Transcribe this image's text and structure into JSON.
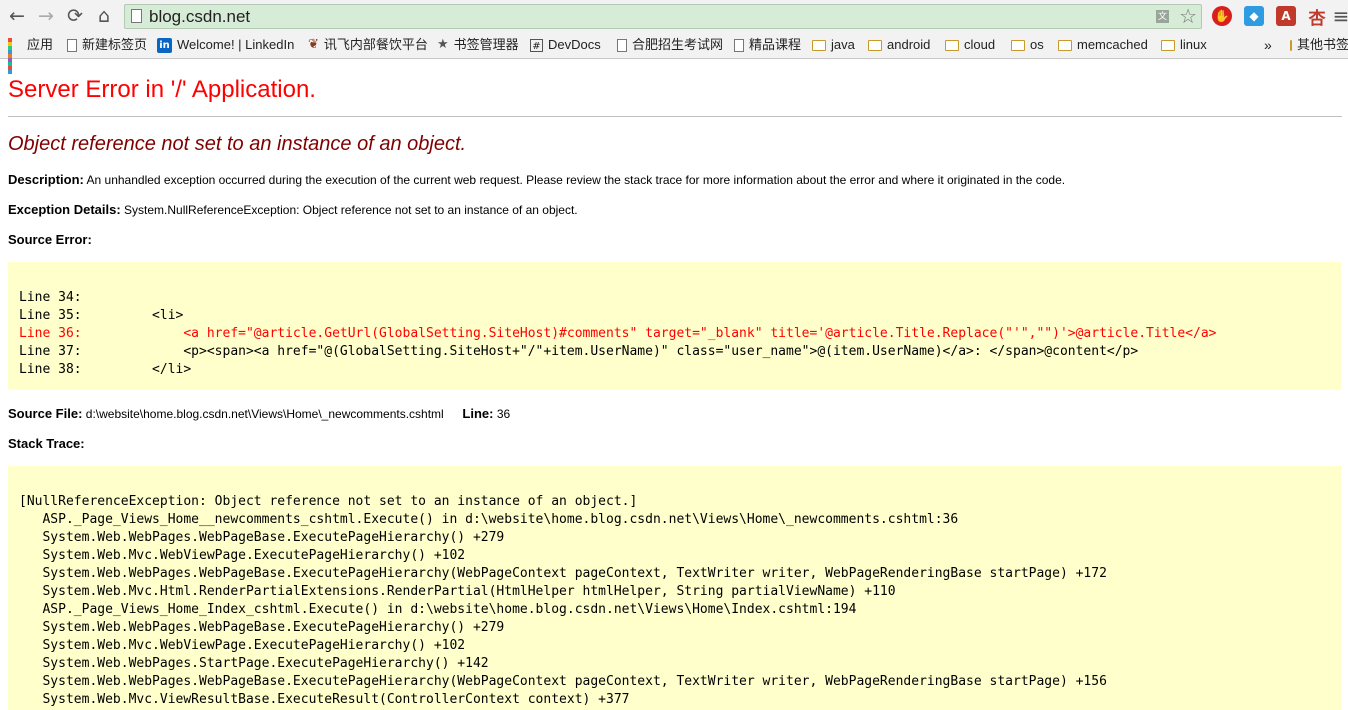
{
  "browser": {
    "url": "blog.csdn.net",
    "nav_icons": {
      "back": "←",
      "forward": "→",
      "reload": "⟳",
      "home": "⌂"
    },
    "translate_icon": "文",
    "star_icon": "☆",
    "extensions": [
      {
        "name": "adblock-extension-icon",
        "glyph": "✋",
        "color": "#d81e1e"
      },
      {
        "name": "sync-extension-icon",
        "glyph": "◆",
        "color": "#2f9be0"
      },
      {
        "name": "a-extension-icon",
        "glyph": "A",
        "color": "#c0392b"
      },
      {
        "name": "xing-extension-icon",
        "glyph": "杏",
        "color": "#ffffff"
      }
    ],
    "menu_icon": "≡",
    "bookmarks": [
      {
        "label": "应用",
        "icon": "apps"
      },
      {
        "label": "新建标签页",
        "icon": "doc"
      },
      {
        "label": "Welcome! | LinkedIn",
        "icon": "linkedin"
      },
      {
        "label": "讯飞内部餐饮平台",
        "icon": "food"
      },
      {
        "label": "书签管理器",
        "icon": "star"
      },
      {
        "label": "DevDocs",
        "icon": "hash"
      },
      {
        "label": "合肥招生考试网",
        "icon": "doc"
      },
      {
        "label": "精品课程",
        "icon": "doc"
      },
      {
        "label": "java",
        "icon": "folder"
      },
      {
        "label": "android",
        "icon": "folder"
      },
      {
        "label": "cloud",
        "icon": "folder"
      },
      {
        "label": "os",
        "icon": "folder"
      },
      {
        "label": "memcached",
        "icon": "folder"
      },
      {
        "label": "linux",
        "icon": "folder"
      }
    ],
    "overflow": "»",
    "other_bookmarks": "其他书签"
  },
  "page": {
    "title": "Server Error in '/' Application.",
    "message": "Object reference not set to an instance of an object.",
    "description_label": "Description:",
    "description": "An unhandled exception occurred during the execution of the current web request. Please review the stack trace for more information about the error and where it originated in the code.",
    "exception_label": "Exception Details:",
    "exception": "System.NullReferenceException: Object reference not set to an instance of an object.",
    "source_error_label": "Source Error:",
    "source_lines": [
      {
        "text": "Line 34:",
        "error": false
      },
      {
        "text": "Line 35:         <li>",
        "error": false
      },
      {
        "text": "Line 36:             <a href=\"@article.GetUrl(GlobalSetting.SiteHost)#comments\" target=\"_blank\" title='@article.Title.Replace(\"'\",\"\")'>@article.Title</a>",
        "error": true
      },
      {
        "text": "Line 37:             <p><span><a href=\"@(GlobalSetting.SiteHost+\"/\"+item.UserName)\" class=\"user_name\">@(item.UserName)</a>: </span>@content</p>",
        "error": false
      },
      {
        "text": "Line 38:         </li>",
        "error": false
      }
    ],
    "source_file_label": "Source File:",
    "source_file": "d:\\website\\home.blog.csdn.net\\Views\\Home\\_newcomments.cshtml",
    "line_label": "Line:",
    "line_number": "36",
    "stack_trace_label": "Stack Trace:",
    "stack_lines": [
      "[NullReferenceException: Object reference not set to an instance of an object.]",
      "   ASP._Page_Views_Home__newcomments_cshtml.Execute() in d:\\website\\home.blog.csdn.net\\Views\\Home\\_newcomments.cshtml:36",
      "   System.Web.WebPages.WebPageBase.ExecutePageHierarchy() +279",
      "   System.Web.Mvc.WebViewPage.ExecutePageHierarchy() +102",
      "   System.Web.WebPages.WebPageBase.ExecutePageHierarchy(WebPageContext pageContext, TextWriter writer, WebPageRenderingBase startPage) +172",
      "   System.Web.Mvc.Html.RenderPartialExtensions.RenderPartial(HtmlHelper htmlHelper, String partialViewName) +110",
      "   ASP._Page_Views_Home_Index_cshtml.Execute() in d:\\website\\home.blog.csdn.net\\Views\\Home\\Index.cshtml:194",
      "   System.Web.WebPages.WebPageBase.ExecutePageHierarchy() +279",
      "   System.Web.Mvc.WebViewPage.ExecutePageHierarchy() +102",
      "   System.Web.WebPages.StartPage.ExecutePageHierarchy() +142",
      "   System.Web.WebPages.WebPageBase.ExecutePageHierarchy(WebPageContext pageContext, TextWriter writer, WebPageRenderingBase startPage) +156",
      "   System.Web.Mvc.ViewResultBase.ExecuteResult(ControllerContext context) +377"
    ]
  }
}
